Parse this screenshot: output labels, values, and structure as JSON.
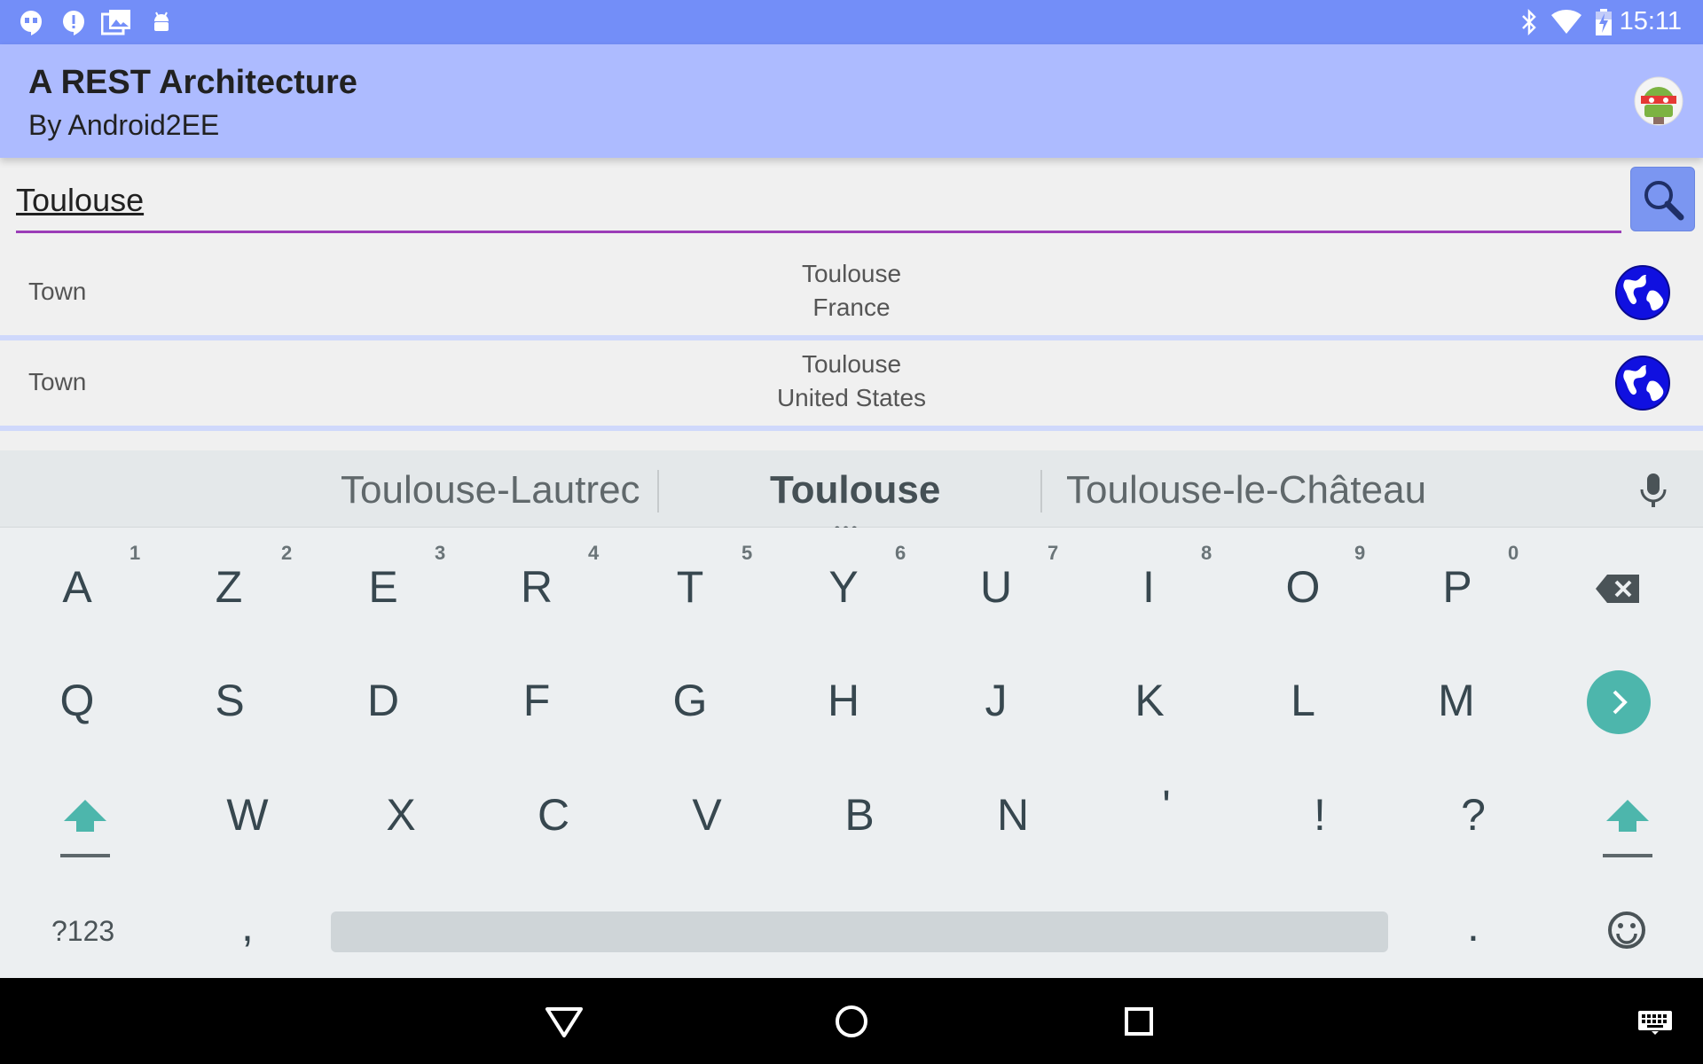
{
  "status_bar": {
    "time": "15:11",
    "left_icons": [
      "hangouts-icon",
      "alert-icon",
      "gallery-icon",
      "android-icon"
    ],
    "right_icons": [
      "bluetooth-icon",
      "wifi-icon",
      "battery-charging-icon"
    ],
    "background": "#738ef8"
  },
  "app_bar": {
    "title": "A REST Architecture",
    "subtitle": "By Android2EE",
    "background": "#adbbff",
    "avatar_icon": "android-robot-avatar-icon"
  },
  "search": {
    "value": "Toulouse",
    "button_icon": "search-icon",
    "underline_color": "#9b3db8"
  },
  "results": [
    {
      "type": "Town",
      "name": "Toulouse",
      "country": "France",
      "icon": "globe-icon"
    },
    {
      "type": "Town",
      "name": "Toulouse",
      "country": "United States",
      "icon": "globe-icon"
    }
  ],
  "keyboard": {
    "suggestions": [
      "Toulouse-Lautrec",
      "Toulouse",
      "Toulouse-le-Château"
    ],
    "row1": [
      "A",
      "Z",
      "E",
      "R",
      "T",
      "Y",
      "U",
      "I",
      "O",
      "P"
    ],
    "row1_hints": [
      "1",
      "2",
      "3",
      "4",
      "5",
      "6",
      "7",
      "8",
      "9",
      "0"
    ],
    "row2": [
      "Q",
      "S",
      "D",
      "F",
      "G",
      "H",
      "J",
      "K",
      "L",
      "M"
    ],
    "row3": [
      "W",
      "X",
      "C",
      "V",
      "B",
      "N",
      "'",
      "!",
      "?"
    ],
    "symbols_key": "?123",
    "comma_key": ",",
    "period_key": ".",
    "accent_color": "#4db6ac"
  },
  "nav_bar": {
    "icons": [
      "back-icon",
      "home-icon",
      "recents-icon",
      "keyboard-switch-icon"
    ]
  }
}
